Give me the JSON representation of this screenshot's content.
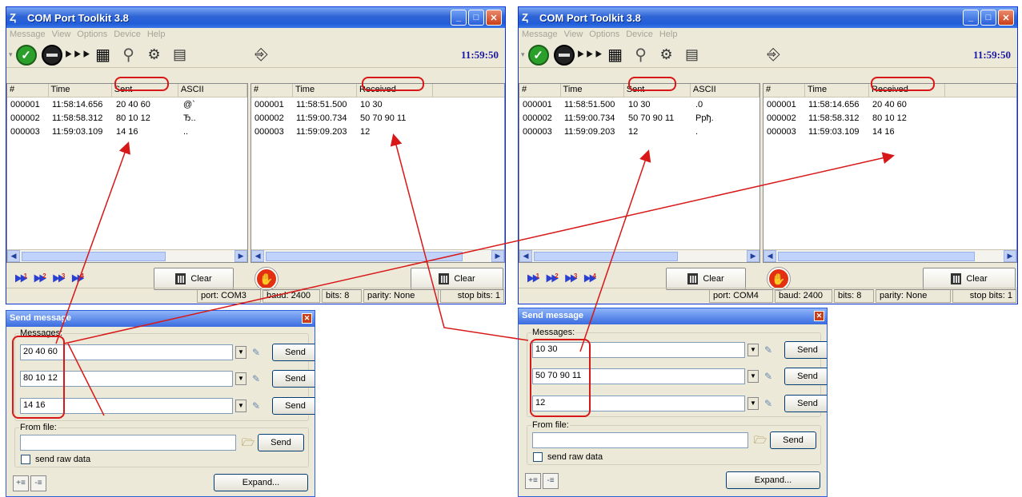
{
  "left": {
    "title": "COM Port Toolkit 3.8",
    "menu": [
      "Message",
      "View",
      "Options",
      "Device",
      "Help"
    ],
    "clock": "11:59:50",
    "sent": {
      "headers": [
        "#",
        "Time",
        "Sent",
        "ASCII"
      ],
      "rows": [
        [
          "000001",
          "11:58:14.656",
          "20 40 60",
          " @`"
        ],
        [
          "000002",
          "11:58:58.312",
          "80 10 12",
          "Ђ.."
        ],
        [
          "000003",
          "11:59:03.109",
          "14 16",
          ".."
        ]
      ]
    },
    "recv": {
      "headers": [
        "#",
        "Time",
        "Received"
      ],
      "rows": [
        [
          "000001",
          "11:58:51.500",
          "10 30"
        ],
        [
          "000002",
          "11:59:00.734",
          "50 70 90 11"
        ],
        [
          "000003",
          "11:59:09.203",
          "12"
        ]
      ]
    },
    "clear": "Clear",
    "status": {
      "port": "port: COM3",
      "baud": "baud: 2400",
      "bits": "bits: 8",
      "parity": "parity: None",
      "stop": "stop bits: 1"
    }
  },
  "right": {
    "title": "COM Port Toolkit 3.8",
    "menu": [
      "Message",
      "View",
      "Options",
      "Device",
      "Help"
    ],
    "clock": "11:59:50",
    "sent": {
      "headers": [
        "#",
        "Time",
        "Sent",
        "ASCII"
      ],
      "rows": [
        [
          "000001",
          "11:58:51.500",
          "10 30",
          ".0"
        ],
        [
          "000002",
          "11:59:00.734",
          "50 70 90 11",
          "Ppђ."
        ],
        [
          "000003",
          "11:59:09.203",
          "12",
          "."
        ]
      ]
    },
    "recv": {
      "headers": [
        "#",
        "Time",
        "Received"
      ],
      "rows": [
        [
          "000001",
          "11:58:14.656",
          "20 40 60"
        ],
        [
          "000002",
          "11:58:58.312",
          "80 10 12"
        ],
        [
          "000003",
          "11:59:03.109",
          "14 16"
        ]
      ]
    },
    "clear": "Clear",
    "status": {
      "port": "port: COM4",
      "baud": "baud: 2400",
      "bits": "bits: 8",
      "parity": "parity: None",
      "stop": "stop bits: 1"
    }
  },
  "dlg_left": {
    "title": "Send message",
    "messages_label": "Messages:",
    "messages": [
      "20 40 60",
      "80 10 12",
      "14 16"
    ],
    "send": "Send",
    "from_file": "From file:",
    "raw": "send raw data",
    "expand": "Expand..."
  },
  "dlg_right": {
    "title": "Send message",
    "messages_label": "Messages:",
    "messages": [
      "10 30",
      "50 70 90 11",
      "12"
    ],
    "send": "Send",
    "from_file": "From file:",
    "raw": "send raw data",
    "expand": "Expand..."
  },
  "colors": {
    "annotation": "#d81818",
    "clock": "#1a1aa8",
    "title_bar": "#2f64d6"
  },
  "icons": [
    "start-icon",
    "stop-icon",
    "send-sequence-icon",
    "log-view-icon",
    "port-config-icon",
    "device-icon",
    "terminal-icon",
    "exit-door-icon",
    "trash-bin-icon",
    "stop-hand-icon"
  ]
}
